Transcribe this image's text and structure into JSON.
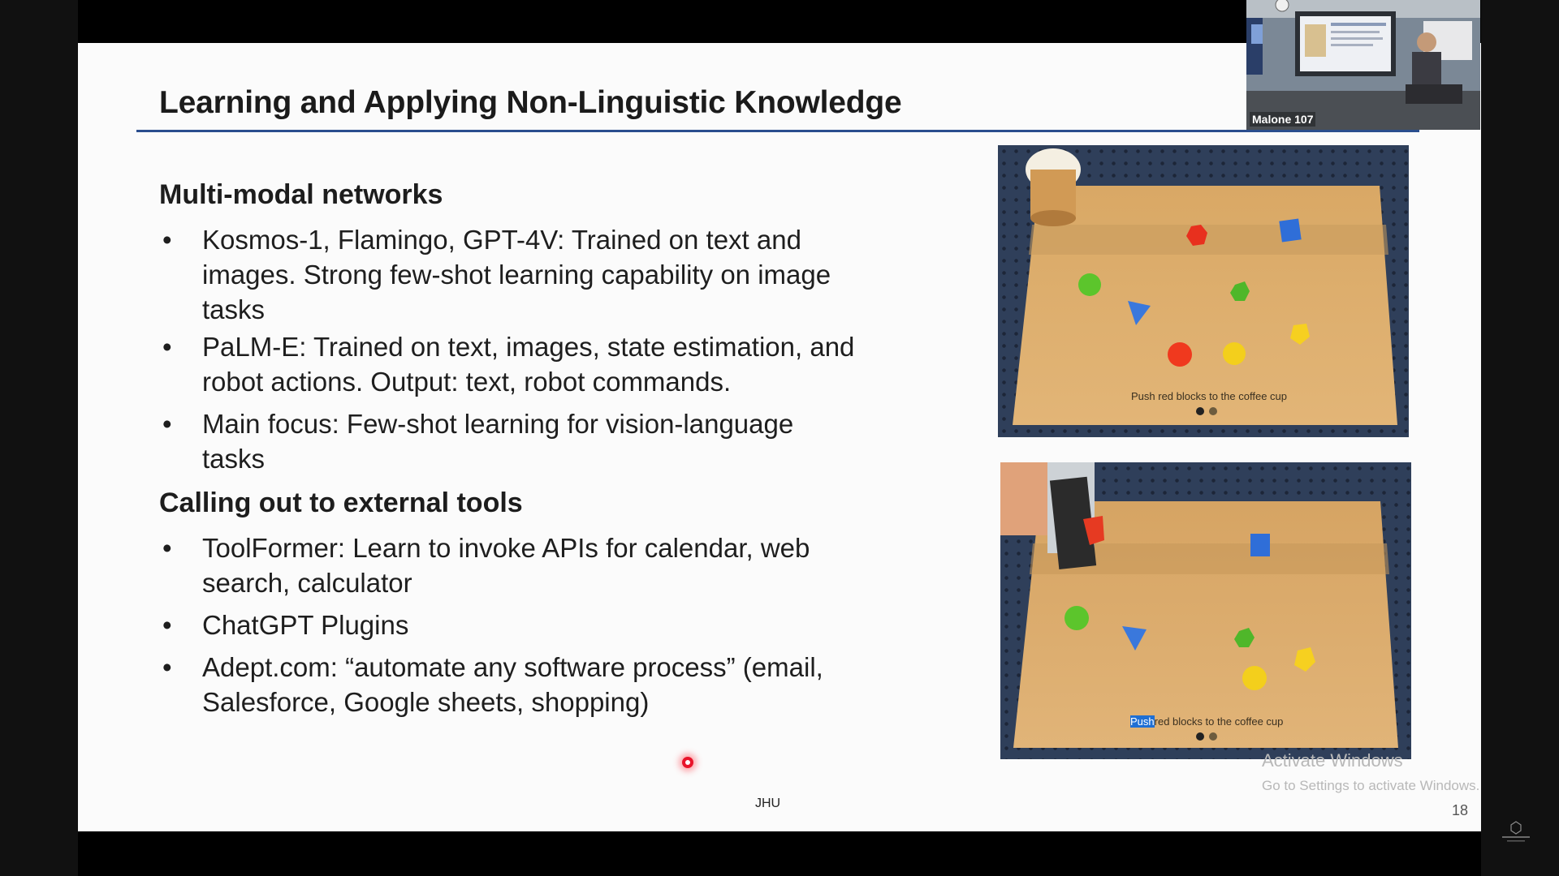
{
  "slide": {
    "title": "Learning and Applying Non-Linguistic Knowledge",
    "sections": [
      {
        "heading": "Multi-modal networks",
        "bullets": [
          "Kosmos-1, Flamingo, GPT-4V: Trained on text and images. Strong few-shot learning capability on image tasks",
          "PaLM-E: Trained on text, images, state estimation, and robot actions. Output: text, robot commands.",
          "Main focus: Few-shot learning for vision-language tasks"
        ]
      },
      {
        "heading": "Calling out to external tools",
        "bullets": [
          "ToolFormer: Learn to invoke APIs for calendar, web search, calculator",
          "ChatGPT Plugins",
          "Adept.com: “automate any software process” (email, Salesforce, Google sheets, shopping)"
        ]
      }
    ],
    "bullet_glyph": "•",
    "footer": "JHU",
    "page_number": "18"
  },
  "images": [
    {
      "caption": "Push red blocks to the coffee cup",
      "highlight": ""
    },
    {
      "caption": "red blocks to the coffee cup",
      "highlight": "Push"
    }
  ],
  "windows_watermark": {
    "line1": "Activate Windows",
    "line2": "Go to Settings to activate Windows."
  },
  "webcam": {
    "label": "Malone 107"
  },
  "colors": {
    "title_rule": "#2a4e8e",
    "laser_pointer": "#e8142a",
    "caption_highlight": "#1f6fd4"
  }
}
